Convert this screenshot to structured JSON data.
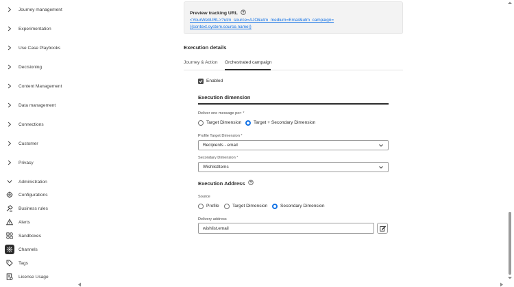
{
  "sidebar": {
    "collapsed_items": [
      {
        "label": "Journey management"
      },
      {
        "label": "Experimentation"
      },
      {
        "label": "Use Case Playbooks"
      },
      {
        "label": "Decisioning"
      },
      {
        "label": "Content Management"
      },
      {
        "label": "Data management"
      },
      {
        "label": "Connections"
      },
      {
        "label": "Customer"
      },
      {
        "label": "Privacy"
      }
    ],
    "admin_label": "Administration",
    "admin_items": [
      {
        "label": "Configurations",
        "icon": "gear-icon"
      },
      {
        "label": "Business rules",
        "icon": "rules-icon"
      },
      {
        "label": "Alerts",
        "icon": "alert-icon"
      },
      {
        "label": "Sandboxes",
        "icon": "sandbox-icon"
      },
      {
        "label": "Channels",
        "icon": "channels-icon",
        "active": true
      },
      {
        "label": "Tags",
        "icon": "tag-icon"
      },
      {
        "label": "License Usage",
        "icon": "license-icon"
      }
    ]
  },
  "tracking": {
    "title": "Preview tracking URL",
    "url_line1": "<YourWebURL>?utm_source=AJO&utm_medium=Email&utm_campaign=",
    "url_line2": "{{context.system.source.name}}"
  },
  "execution": {
    "title": "Execution details",
    "tabs": [
      "Journey & Action",
      "Orchestrated campaign"
    ],
    "active_tab": "Orchestrated campaign",
    "enabled_label": "Enabled",
    "enabled": true,
    "dimension_title": "Execution dimension",
    "deliver_label": "Deliver one message per:",
    "deliver_options": [
      "Target Dimension",
      "Target + Secondary Dimension"
    ],
    "deliver_selected": "Target + Secondary Dimension",
    "profile_target_label": "Profile Target Dimension",
    "profile_target_value": "Recipients - email",
    "secondary_label": "Secondary Dimension",
    "secondary_value": "WishlistItems",
    "address_title": "Execution Address",
    "source_label": "Source",
    "source_options": [
      "Profile",
      "Target Dimension",
      "Secondary Dimension"
    ],
    "source_selected": "Secondary Dimension",
    "delivery_label": "Delivery address",
    "delivery_value": "wishlist.email",
    "required_mark": "*"
  },
  "colors": {
    "accent": "#1473e6",
    "text": "#2c2c2c",
    "active_bg": "#2c2c2c"
  }
}
